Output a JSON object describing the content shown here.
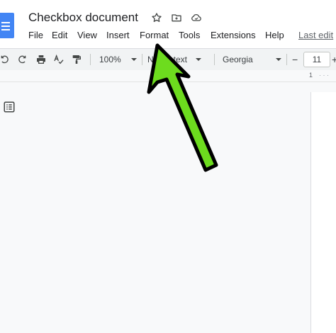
{
  "document": {
    "title": "Checkbox document"
  },
  "header_icons": [
    {
      "name": "star-icon"
    },
    {
      "name": "move-folder-icon"
    },
    {
      "name": "cloud-status-icon"
    }
  ],
  "menu": {
    "items": [
      "File",
      "Edit",
      "View",
      "Insert",
      "Format",
      "Tools",
      "Extensions",
      "Help"
    ],
    "last_edit": "Last edit"
  },
  "toolbar": {
    "zoom": "100%",
    "style_prefix": "N",
    "style_suffix": "text",
    "font": "Georgia",
    "decrease": "−",
    "font_size": "11",
    "increase": "+"
  },
  "ruler": {
    "number": "1"
  },
  "colors": {
    "arrow_fill": "#6ddc1e",
    "arrow_stroke": "#000000",
    "docs_blue": "#4285f4"
  }
}
